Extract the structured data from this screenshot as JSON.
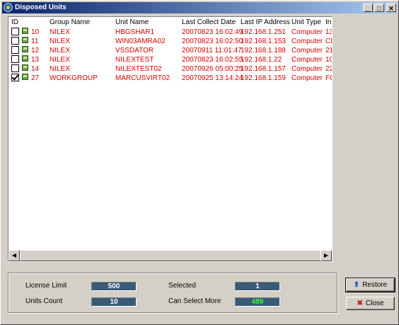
{
  "window": {
    "title": "Disposed Units",
    "minimize": "_",
    "maximize": "□",
    "close": "✕"
  },
  "list": {
    "columns": [
      "ID",
      "Group Name",
      "Unit Name",
      "Last Collect Date",
      "Last IP Address",
      "Unit Type",
      "In"
    ],
    "rows": [
      {
        "checked": false,
        "id": "10",
        "group": "NILEX",
        "unit": "HBGSHAR1",
        "date": "20070823 16:02:49",
        "ip": "192.168.1.251",
        "type": "Computer",
        "extra": "13"
      },
      {
        "checked": false,
        "id": "11",
        "group": "NILEX",
        "unit": "WIN03AMRA02",
        "date": "20070823 16:02:50",
        "ip": "192.168.1.153",
        "type": "Computer",
        "extra": "CE"
      },
      {
        "checked": false,
        "id": "12",
        "group": "NILEX",
        "unit": "VSSDATOR",
        "date": "20070911 11:01:47",
        "ip": "192.168.1.188",
        "type": "Computer",
        "extra": "21"
      },
      {
        "checked": false,
        "id": "13",
        "group": "NILEX",
        "unit": "NILEXTEST",
        "date": "20070823 16:02:55",
        "ip": "192.168.1.22",
        "type": "Computer",
        "extra": "10"
      },
      {
        "checked": false,
        "id": "14",
        "group": "NILEX",
        "unit": "NILEXTEST02",
        "date": "20070926 05:00:25",
        "ip": "192.168.1.157",
        "type": "Computer",
        "extra": "22"
      },
      {
        "checked": true,
        "id": "27",
        "group": "WORKGROUP",
        "unit": "MARCUSVIRT02",
        "date": "20070925 13:14:24",
        "ip": "192.168.1.159",
        "type": "Computer",
        "extra": "FC"
      }
    ]
  },
  "info": {
    "license_limit_label": "License Limit",
    "license_limit": "500",
    "units_count_label": "Units Count",
    "units_count": "10",
    "selected_label": "Selected",
    "selected": "1",
    "can_select_more_label": "Can Select More",
    "can_select_more": "489"
  },
  "buttons": {
    "restore": "Restore",
    "close": "Close"
  },
  "colors": {
    "row_text": "#d40000",
    "value_box": "#3a5a78",
    "highlight_value": "#33ff33"
  }
}
